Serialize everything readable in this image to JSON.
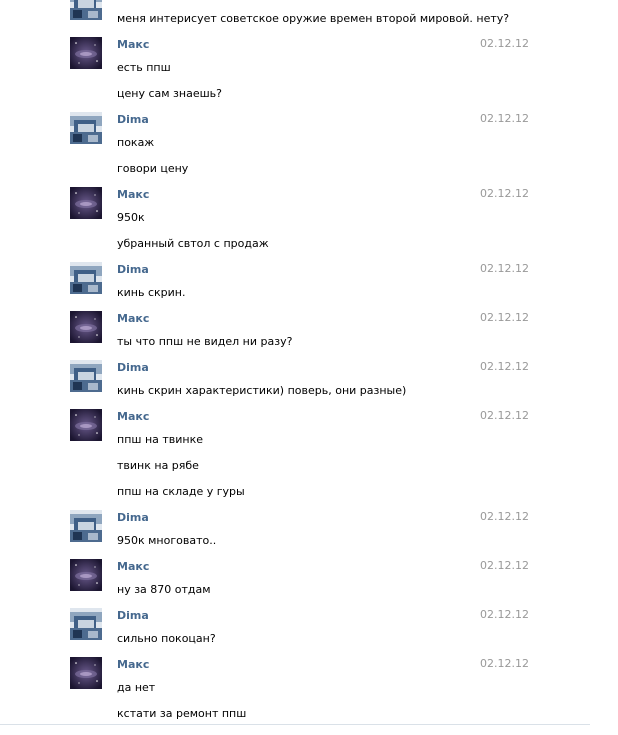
{
  "messages": [
    {
      "author": "",
      "avatar": "dima",
      "date": "",
      "lines": [
        "меня интерисует советское оружие времен второй мировой. нету?"
      ]
    },
    {
      "author": "Макс",
      "avatar": "maks",
      "date": "02.12.12",
      "lines": [
        "есть ппш",
        "цену сам знаешь?"
      ]
    },
    {
      "author": "Dima",
      "avatar": "dima",
      "date": "02.12.12",
      "lines": [
        "покаж",
        "говори цену"
      ]
    },
    {
      "author": "Макс",
      "avatar": "maks",
      "date": "02.12.12",
      "lines": [
        "950к",
        "убранный свтол с продаж"
      ]
    },
    {
      "author": "Dima",
      "avatar": "dima",
      "date": "02.12.12",
      "lines": [
        "кинь скрин."
      ]
    },
    {
      "author": "Макс",
      "avatar": "maks",
      "date": "02.12.12",
      "lines": [
        "ты что ппш не видел ни разу?"
      ]
    },
    {
      "author": "Dima",
      "avatar": "dima",
      "date": "02.12.12",
      "lines": [
        "кинь скрин характеристики) поверь, они разные)"
      ]
    },
    {
      "author": "Макс",
      "avatar": "maks",
      "date": "02.12.12",
      "lines": [
        "ппш на твинке",
        "твинк на рябе",
        "ппш на складе у гуры"
      ]
    },
    {
      "author": "Dima",
      "avatar": "dima",
      "date": "02.12.12",
      "lines": [
        "950к многовато.."
      ]
    },
    {
      "author": "Макс",
      "avatar": "maks",
      "date": "02.12.12",
      "lines": [
        "ну за 870 отдам"
      ]
    },
    {
      "author": "Dima",
      "avatar": "dima",
      "date": "02.12.12",
      "lines": [
        "сильно покоцан?"
      ]
    },
    {
      "author": "Макс",
      "avatar": "maks",
      "date": "02.12.12",
      "lines": [
        "да нет",
        "кстати за ремонт ппш"
      ]
    }
  ],
  "colors": {
    "author": "#45688e",
    "date": "#999999",
    "text": "#000000",
    "background": "#ffffff"
  }
}
